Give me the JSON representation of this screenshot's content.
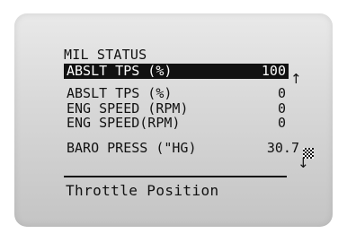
{
  "screen": {
    "header": "MIL STATUS",
    "rows": [
      {
        "label": "ABSLT TPS (%)",
        "value": "100",
        "selected": true
      },
      {
        "label": "ABSLT TPS (%)",
        "value": "0",
        "selected": false
      },
      {
        "label": "ENG SPEED (RPM)",
        "value": "0",
        "selected": false
      },
      {
        "label": "ENG SPEED(RPM)",
        "value": "0",
        "selected": false
      },
      {
        "label": "BARO PRESS (\"HG)",
        "value": "30.7",
        "selected": false
      }
    ],
    "footer": "Throttle Position",
    "icons": {
      "scroll_up": "arrow-up-icon",
      "scroll_down": "arrow-down-icon",
      "scroll_thumb": "scroll-thumb"
    }
  }
}
